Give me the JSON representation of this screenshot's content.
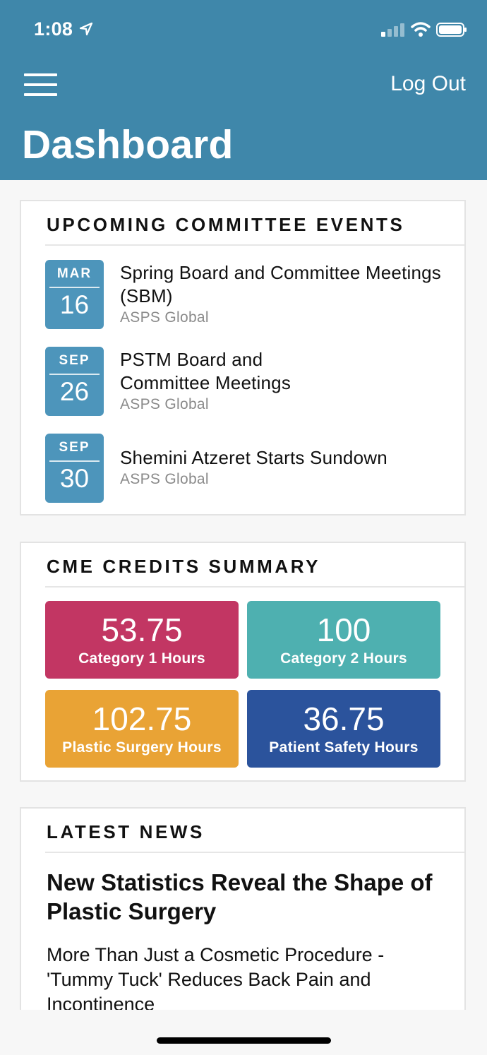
{
  "status_bar": {
    "time": "1:08"
  },
  "header": {
    "logout_label": "Log Out",
    "title": "Dashboard"
  },
  "events_card": {
    "title": "UPCOMING COMMITTEE EVENTS",
    "events": [
      {
        "month": "MAR",
        "day": "16",
        "title": "Spring Board and Committee Meetings (SBM)",
        "org": "ASPS Global"
      },
      {
        "month": "SEP",
        "day": "26",
        "title": "PSTM Board and Committee Meetings",
        "org": "ASPS Global"
      },
      {
        "month": "SEP",
        "day": "30",
        "title": "Shemini Atzeret Starts Sundown",
        "org": "ASPS Global"
      }
    ]
  },
  "cme_card": {
    "title": "CME CREDITS SUMMARY",
    "tiles": [
      {
        "value": "53.75",
        "label": "Category 1 Hours",
        "color": "#c23663"
      },
      {
        "value": "100",
        "label": "Category 2 Hours",
        "color": "#4eb0b0"
      },
      {
        "value": "102.75",
        "label": "Plastic Surgery Hours",
        "color": "#e9a335"
      },
      {
        "value": "36.75",
        "label": "Patient Safety Hours",
        "color": "#2b539c"
      }
    ]
  },
  "news_card": {
    "title": "LATEST NEWS",
    "headline": "New Statistics Reveal the Shape of Plastic Surgery",
    "subheadline": "More Than Just a Cosmetic Procedure - 'Tummy Tuck' Reduces Back Pain and Incontinence"
  },
  "colors": {
    "header_bg": "#3f87aa",
    "date_badge": "#4d95bb"
  }
}
